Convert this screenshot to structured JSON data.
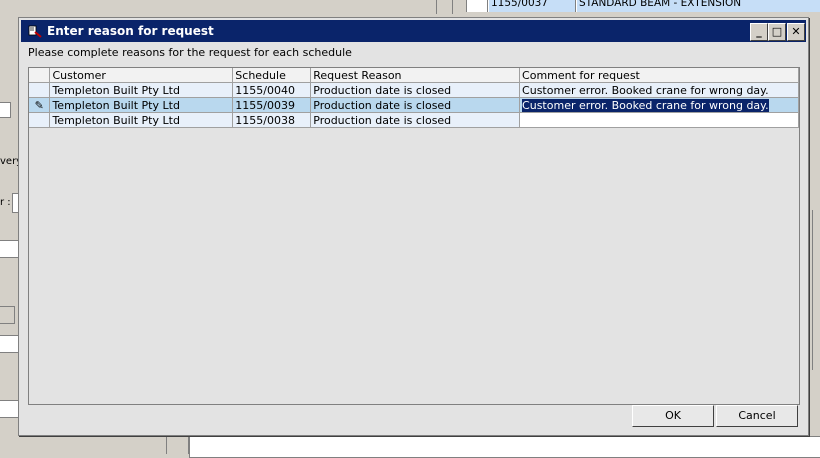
{
  "background": {
    "top_row": {
      "schedule": "1155/0037",
      "description": "STANDARD BEAM - EXTENSION"
    },
    "side_label_1": "very",
    "side_label_2": "r :"
  },
  "dialog": {
    "title": "Enter reason for request",
    "instructions": "Please complete reasons for the request for each schedule",
    "title_buttons": {
      "minimize": "_",
      "maximize": "□",
      "close": "✕"
    },
    "grid": {
      "columns": [
        "Customer",
        "Schedule",
        "Request Reason",
        "Comment for request"
      ],
      "rows": [
        {
          "indicator": "",
          "customer": "Templeton Built Pty Ltd",
          "schedule": "1155/0040",
          "reason": "Production date is closed",
          "comment": "Customer error. Booked crane for wrong day."
        },
        {
          "indicator": "✎",
          "customer": "Templeton Built Pty Ltd",
          "schedule": "1155/0039",
          "reason": "Production date is closed",
          "comment": "Customer error. Booked crane for wrong day."
        },
        {
          "indicator": "",
          "customer": "Templeton Built Pty Ltd",
          "schedule": "1155/0038",
          "reason": "Production date is closed",
          "comment": ""
        }
      ]
    },
    "ok_label": "OK",
    "cancel_label": "Cancel"
  }
}
